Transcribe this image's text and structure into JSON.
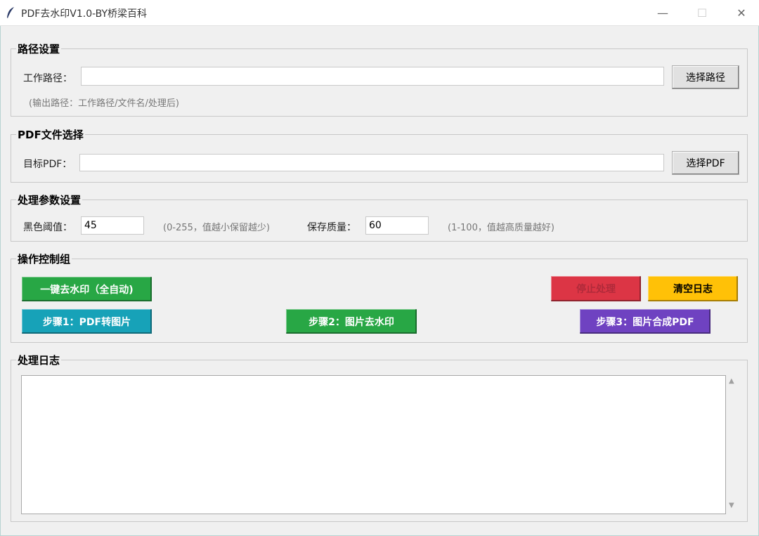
{
  "window": {
    "title": "PDF去水印V1.0-BY桥梁百科",
    "min_glyph": "—",
    "max_glyph": "☐",
    "close_glyph": "✕"
  },
  "path_group": {
    "title": "路径设置",
    "work_path_label": "工作路径：",
    "work_path_value": "",
    "choose_button": "选择路径",
    "output_hint": "(输出路径：工作路径/文件名/处理后)"
  },
  "pdf_group": {
    "title": "PDF文件选择",
    "target_label": "目标PDF：",
    "target_value": "",
    "choose_button": "选择PDF"
  },
  "params_group": {
    "title": "处理参数设置",
    "threshold_label": "黑色阈值：",
    "threshold_value": "45",
    "threshold_hint": "(0-255，值越小保留越少)",
    "quality_label": "保存质量：",
    "quality_value": "60",
    "quality_hint": "(1-100，值越高质量越好)"
  },
  "ops_group": {
    "title": "操作控制组",
    "auto_button": "一键去水印（全自动)",
    "stop_button": "停止处理",
    "clear_button": "清空日志",
    "step1_button": "步骤1：PDF转图片",
    "step2_button": "步骤2：图片去水印",
    "step3_button": "步骤3：图片合成PDF"
  },
  "log_group": {
    "title": "处理日志",
    "content": ""
  },
  "colors": {
    "green": "#28a745",
    "cyan": "#17a2b8",
    "red": "#dc3545",
    "yellow": "#ffc107",
    "purple": "#6f42c1"
  },
  "icons": {
    "app": "feather-icon",
    "scroll_up": "▲",
    "scroll_down": "▼"
  }
}
